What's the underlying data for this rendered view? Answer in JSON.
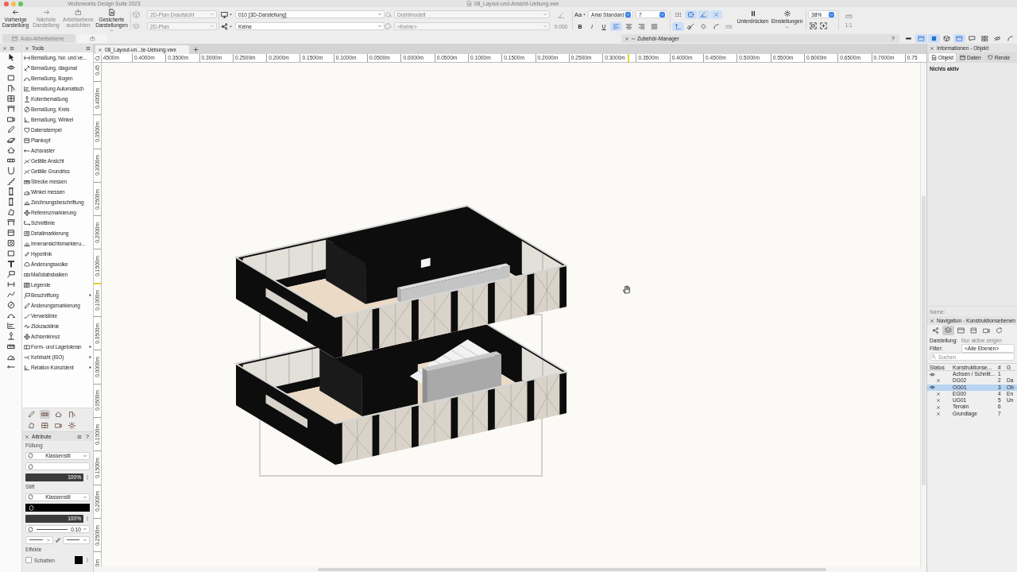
{
  "window": {
    "title": "Vectorworks Design Suite 2023",
    "document": "08_Layout-und-Ansicht-Uebung.vwx"
  },
  "toolbar": {
    "view_buttons": [
      {
        "label": "Vorherige Darstellung",
        "disabled": false
      },
      {
        "label": "Nächste Darstellung",
        "disabled": true
      },
      {
        "label": "Arbeitsebene ausrichten",
        "disabled": true
      },
      {
        "label": "Gesicherte Darstellungen",
        "disabled": false
      }
    ],
    "view_selectors": [
      [
        {
          "value": "2D-Plan Draufsicht",
          "disabled": true
        },
        {
          "value": "2D-Plan",
          "disabled": true
        }
      ],
      [
        {
          "value": "010 [3D-Darstellung]",
          "disabled": false
        },
        {
          "value": "Keine",
          "disabled": false
        }
      ],
      [
        {
          "value": "Drahtmodell",
          "disabled": true
        },
        {
          "value": "<Keine>",
          "disabled": true
        }
      ]
    ],
    "offset": {
      "value": "0.000",
      "disabled": true
    },
    "text": {
      "case_menu": "Aa",
      "font": "Arial Standard",
      "size": "7",
      "styles": [
        {
          "label": "B",
          "selected": false
        },
        {
          "label": "I",
          "selected": false
        },
        {
          "label": "U",
          "selected": false
        }
      ],
      "alignments": [
        {
          "selected": true
        },
        {
          "selected": false
        },
        {
          "selected": false
        },
        {
          "selected": false
        }
      ]
    },
    "snaps": [
      {
        "selected": false,
        "disabled": false
      },
      {
        "selected": true,
        "disabled": false
      },
      {
        "selected": true,
        "disabled": false
      },
      {
        "selected": true,
        "disabled": false
      },
      {
        "selected": true,
        "disabled": false
      },
      {
        "selected": false,
        "disabled": false
      },
      {
        "selected": false,
        "disabled": false
      },
      {
        "selected": false,
        "disabled": false
      },
      {
        "selected": false,
        "disabled": true
      }
    ],
    "actions": [
      {
        "label": "Unterdrücken"
      },
      {
        "label": "Einstellungen"
      }
    ],
    "zoom": "38%",
    "scale": {
      "value": "1:1",
      "disabled": true
    }
  },
  "subbar": {
    "auto_workplane": {
      "label": "Auto-Arbeitsebene",
      "disabled": true
    },
    "accessory_manager": {
      "title": "Zubehör-Manager",
      "help": "?"
    },
    "palette_toggles": [
      {
        "selected": false
      },
      {
        "selected": true
      },
      {
        "selected": true
      },
      {
        "selected": false
      },
      {
        "selected": true
      },
      {
        "selected": false
      },
      {
        "selected": false
      },
      {
        "selected": false
      },
      {
        "selected": false
      }
    ]
  },
  "tools": {
    "title": "Tools",
    "items": [
      {
        "label": "Bemaßung, hor. und ve...",
        "submenu": false
      },
      {
        "label": "Bemaßung, diagonal",
        "submenu": false
      },
      {
        "label": "Bemaßung, Bogen",
        "submenu": false
      },
      {
        "label": "Bemaßung Automatisch",
        "submenu": false
      },
      {
        "label": "Kotenbemaßung",
        "submenu": false
      },
      {
        "label": "Bemaßung, Kreis",
        "submenu": false
      },
      {
        "label": "Bemaßung, Winkel",
        "submenu": false
      },
      {
        "label": "Datenstempel",
        "submenu": false
      },
      {
        "label": "Plankopf",
        "submenu": false
      },
      {
        "label": "Achsraster",
        "submenu": false
      },
      {
        "label": "Gefälle Ansicht",
        "submenu": false
      },
      {
        "label": "Gefälle Grundriss",
        "submenu": false
      },
      {
        "label": "Strecke messen",
        "submenu": false
      },
      {
        "label": "Winkel messen",
        "submenu": false
      },
      {
        "label": "Zeichnungsbeschriftung",
        "submenu": false
      },
      {
        "label": "Referenzmarkierung",
        "submenu": false
      },
      {
        "label": "Schnittlinie",
        "submenu": false
      },
      {
        "label": "Detailmarkierung",
        "submenu": false
      },
      {
        "label": "Innenansichtsmarkieru...",
        "submenu": false
      },
      {
        "label": "Hyperlink",
        "submenu": false
      },
      {
        "label": "Änderungswolke",
        "submenu": false
      },
      {
        "label": "Maßstabsbalken",
        "submenu": false
      },
      {
        "label": "Legende",
        "submenu": false
      },
      {
        "label": "Beschriftung",
        "submenu": true
      },
      {
        "label": "Änderungsmarkierung",
        "submenu": false
      },
      {
        "label": "Verweislinie",
        "submenu": false
      },
      {
        "label": "Zickzacklinie",
        "submenu": false
      },
      {
        "label": "Achsenkreuz",
        "submenu": false
      },
      {
        "label": "Form- und Lagetoleran",
        "submenu": true
      },
      {
        "label": "Kehlnaht (ISO)",
        "submenu": true
      },
      {
        "label": "Relation Koinzident",
        "submenu": true
      }
    ]
  },
  "tool_sets": [
    {
      "selected": false
    },
    {
      "selected": true
    },
    {
      "selected": false
    },
    {
      "selected": false
    },
    {
      "selected": false
    },
    {
      "selected": false
    },
    {
      "selected": false
    },
    {
      "selected": false
    }
  ],
  "attributes": {
    "title": "Attribute",
    "help": "?",
    "fill": {
      "label": "Füllung",
      "style": "Klassenstil",
      "opacity": "100%",
      "level": 1
    },
    "pen": {
      "label": "Stift",
      "style": "Klassenstil",
      "opacity": "100%",
      "level": 1,
      "thickness": "0.10"
    },
    "effects": {
      "label": "Effekte",
      "shadow": {
        "label": "Schatten",
        "checked": false
      }
    }
  },
  "document_tabs": [
    {
      "label": "08_Layout-un...te-Uebung.vwx"
    }
  ],
  "rulers": {
    "horizontal": [
      ".4500m",
      "0.4000m",
      "0.3500m",
      "0.3000m",
      "0.2500m",
      "0.2000m",
      "0.1500m",
      "0.1000m",
      "0.0500m",
      "0.0000m",
      "0.0500m",
      "0.1000m",
      "0.1500m",
      "0.2000m",
      "0.2500m",
      "0.3000m",
      "0.3500m",
      "0.4000m",
      "0.4500m",
      "0.5000m",
      "0.5500m",
      "0.6000m",
      "0.6500m",
      "0.7000m",
      "0.75"
    ],
    "vertical": [
      "0.45",
      "0.4000m",
      "0.3500m",
      "0.3000m",
      "0.2500m",
      "0.2000m",
      "0.1500m",
      "0.1000m",
      "0.0500m",
      "0.0000m",
      "0.0500m",
      "0.1000m",
      "0.1500m",
      "0.2000m",
      "0.2500m",
      "0m"
    ]
  },
  "info_palette": {
    "title": "Informationen - Objekt",
    "tabs": [
      {
        "label": "Objekt",
        "selected": true
      },
      {
        "label": "Daten",
        "selected": false
      },
      {
        "label": "Rende",
        "selected": false
      }
    ],
    "status": "Nichts aktiv",
    "name": {
      "label": "Name:",
      "disabled": true
    }
  },
  "navigation": {
    "title": "Navigation - Konstruktionsebenen",
    "modes": [
      {
        "selected": false
      },
      {
        "selected": true
      },
      {
        "selected": false
      },
      {
        "selected": false
      },
      {
        "selected": false
      },
      {
        "selected": false
      }
    ],
    "display": {
      "label": "Darstellung:",
      "value": "Nur aktive zeigen",
      "disabled": true
    },
    "filter": {
      "label": "Filter:",
      "value": "<Alle Ebenen>"
    },
    "search": {
      "placeholder": "Suchen"
    },
    "columns": [
      "Status",
      "Konstruktionse...",
      "#",
      "G"
    ],
    "rows": [
      {
        "visible": true,
        "name": "Achsen / Schnitt...",
        "number": "1",
        "selected": false
      },
      {
        "visible": false,
        "name": "DG02",
        "number": "2",
        "column_4": "Da",
        "selected": false
      },
      {
        "visible": true,
        "name": "OG01",
        "number": "3",
        "column_4": "Ob",
        "selected": true
      },
      {
        "visible": false,
        "name": "EG00",
        "number": "4",
        "column_4": "En",
        "selected": false
      },
      {
        "visible": false,
        "name": "UG01",
        "number": "5",
        "column_4": "Un",
        "selected": false
      },
      {
        "visible": false,
        "name": "Terrain",
        "number": "6",
        "selected": false
      },
      {
        "visible": false,
        "name": "Grundlage",
        "number": "7",
        "selected": false
      }
    ]
  }
}
